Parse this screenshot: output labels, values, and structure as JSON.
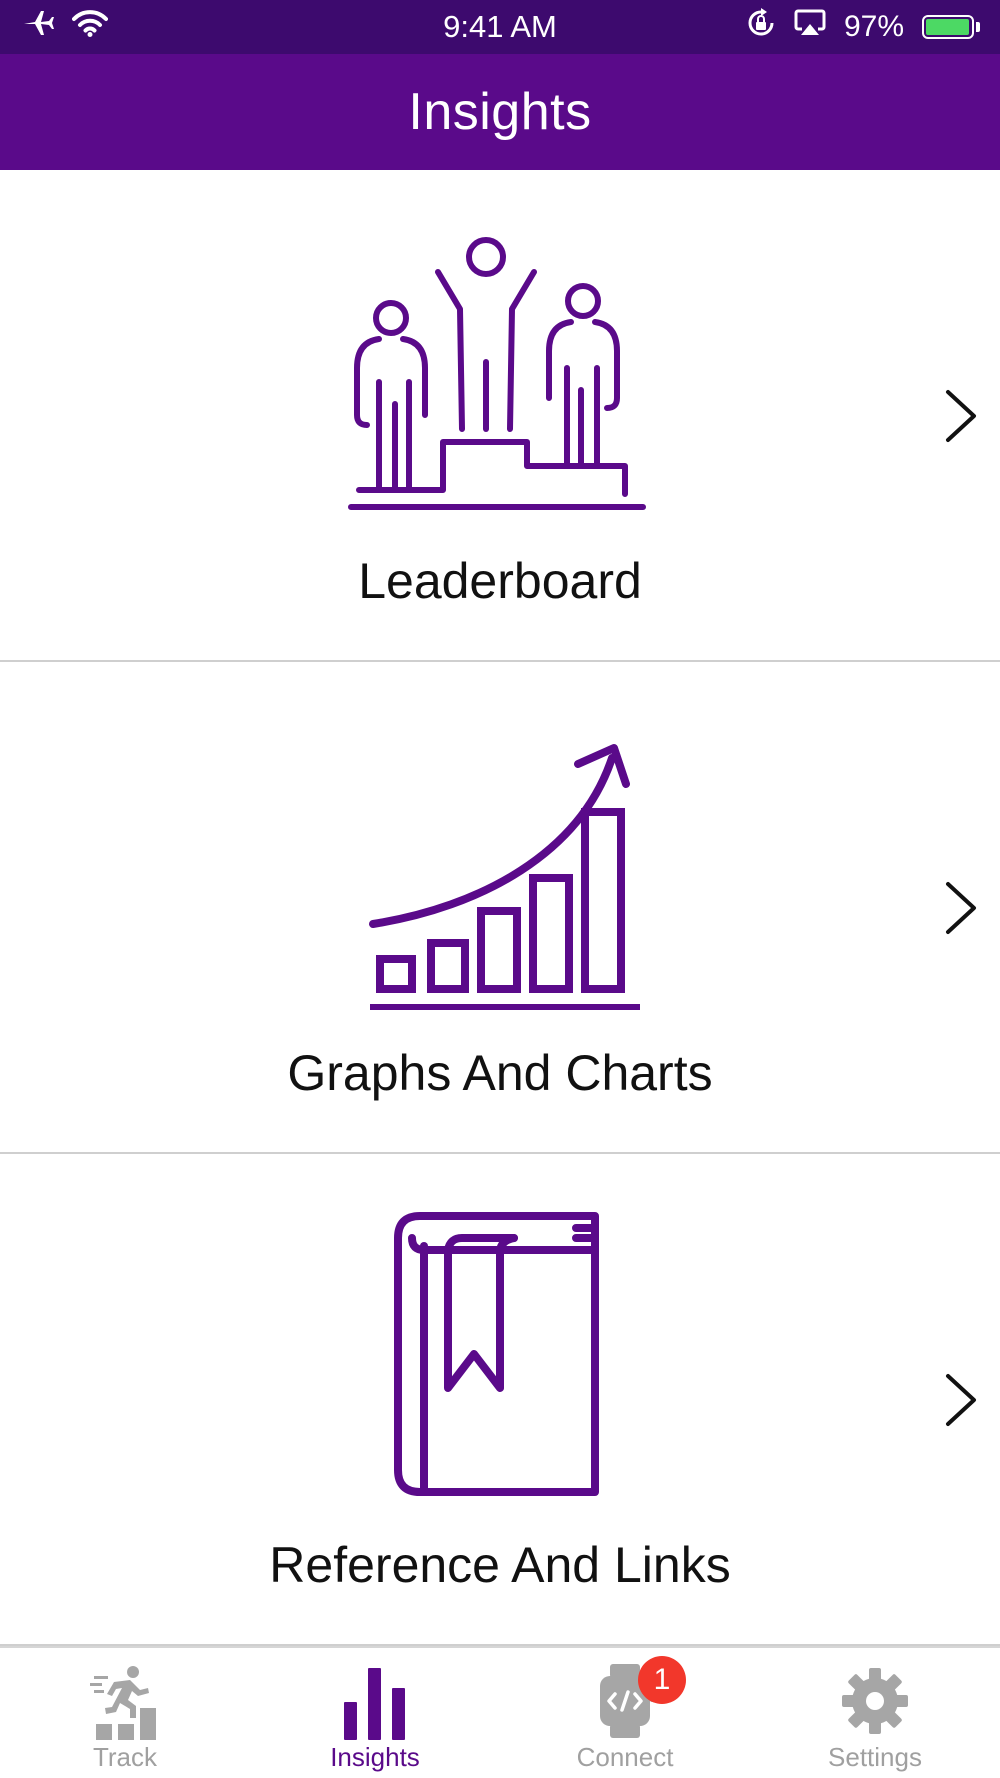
{
  "status_bar": {
    "time": "9:41 AM",
    "battery_percent": "97%",
    "battery_level": 0.97,
    "icons": [
      "airplane-icon",
      "wifi-icon",
      "orientation-lock-icon",
      "airplay-icon",
      "battery-icon"
    ]
  },
  "header": {
    "title": "Insights"
  },
  "menu": [
    {
      "label": "Leaderboard",
      "icon": "podium-icon"
    },
    {
      "label": "Graphs And Charts",
      "icon": "growth-chart-icon"
    },
    {
      "label": "Reference And Links",
      "icon": "book-bookmark-icon"
    }
  ],
  "tabs": [
    {
      "label": "Track",
      "icon": "runner-stairs-icon",
      "active": false
    },
    {
      "label": "Insights",
      "icon": "bar-chart-icon",
      "active": true
    },
    {
      "label": "Connect",
      "icon": "smartwatch-icon",
      "active": false,
      "badge": "1"
    },
    {
      "label": "Settings",
      "icon": "gear-icon",
      "active": false
    }
  ],
  "colors": {
    "status_bar": "#3d0a6e",
    "header": "#5a0a8a",
    "accent": "#5a0a8a",
    "tab_inactive": "#a0a0a0",
    "badge": "#f2372b",
    "battery_fill": "#4cd964"
  }
}
